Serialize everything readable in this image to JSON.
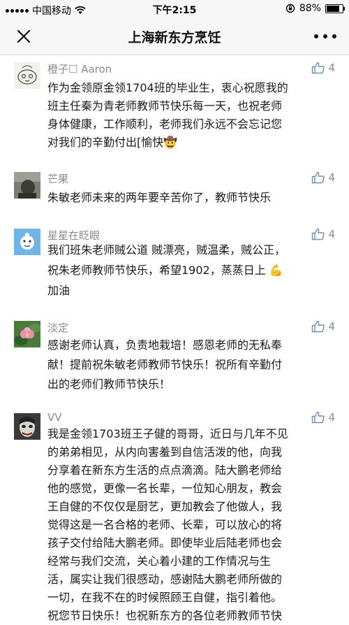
{
  "status_bar": {
    "carrier": "中国移动",
    "time": "下午2:15",
    "battery": "88%",
    "battery_level": 0.88
  },
  "nav": {
    "title": "上海新东方烹饪"
  },
  "comments": [
    {
      "name": "橙子☐ Aaron",
      "likes": "4",
      "text": "作为金领原金领1704班的毕业生，衷心祝愿我的\n班主任秦为青老师教师节快乐每一天，也祝老师\n身体健康，工作顺利，老师我们永远不会忘记您\n对我们的辛勤付出[愉快🤠"
    },
    {
      "name": "芒果",
      "likes": "4",
      "text": "朱敏老师未来的两年要辛苦你了，教师节快乐"
    },
    {
      "name": "星星在眨眼",
      "likes": "4",
      "text": "我们班朱老师贼公道 贼漂亮，贼温柔，贼公正，\n祝朱老师教师节快乐，希望1902，蒸蒸日上 💪\n加油"
    },
    {
      "name": "淡定",
      "likes": "4",
      "text": "感谢老师认真，负责地栽培！感恩老师的无私奉\n献！提前祝朱敏老师教师节快乐！祝所有辛勤付\n出的老师们教师节快乐！"
    },
    {
      "name": "VV",
      "likes": "4",
      "text": "我是金领1703班王子健的哥哥，近日与几年不见\n的弟弟相见，从内向害羞到自信活泼的他，向我\n分享着在新东方生活的点点滴滴。陆大鹏老师给\n他的感觉，更像一名长辈，一位知心朋友，教会\n王自健的不仅仅是厨艺，更加教会了他做人，我\n觉得这是一名合格的老师、长辈，可以放心的将\n孩子交付给陆大鹏老师。即使毕业后陆老师也会\n经常与我们交流，关心着小建的工作情况与生\n活，属实让我们很感动，感谢陆大鹏老师所做的\n一切，在我不在的时候照顾王自健，指引着他。\n祝您节日快乐！也祝新东方的各位老师教师节快"
    }
  ]
}
